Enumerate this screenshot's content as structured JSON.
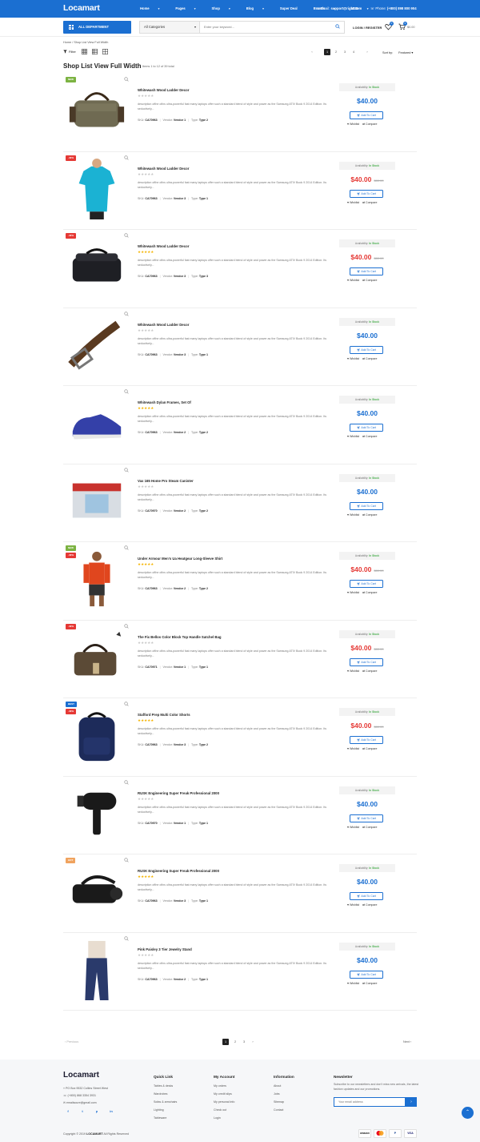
{
  "header": {
    "logo": "Locamart",
    "nav": [
      {
        "label": "Home"
      },
      {
        "label": "Pages"
      },
      {
        "label": "Shop"
      },
      {
        "label": "Blog"
      },
      {
        "label": "Super Deal"
      },
      {
        "label": "Brands"
      },
      {
        "label": "USD"
      }
    ],
    "email_label": "Email:",
    "email": "support@right.com",
    "phone_label": "Phone:",
    "phone": "(+800) 898 800 904",
    "department_label": "ALL DEPARTMENT",
    "category_select": "All Categories",
    "search_placeholder": "Enter your keyword...",
    "login_label": "LOGIN / REGISTER",
    "wishlist_count": "0",
    "cart_count": "0",
    "cart_total": "$0.00"
  },
  "breadcrumb": [
    "Home",
    "Shop List View Full Width"
  ],
  "toolbar": {
    "filter_label": "Filter",
    "pages": [
      "1",
      "2",
      "3",
      "4"
    ],
    "active_page": "1",
    "sort_label": "Sort by:",
    "sort_value": "Featured"
  },
  "page_title": "Shop List View Full Width",
  "results_text": "Items 1 to 12 of 39 total",
  "product_common": {
    "description": "description ofthe ofins ultra-powerful fast many laptops offer such a standard blend of style and power as the Samsung ATIV Book 9 2014 Edition. Its seductively...",
    "availability_label": "Availability:",
    "availability_value": "In Stock",
    "add_to_cart": "Add To Cart",
    "wishlist": "Wishlist",
    "compare": "Compare",
    "sku_label": "SKU:",
    "vendor_label": "Vendor:",
    "type_label": "Type:"
  },
  "products": [
    {
      "title": "Whitewash Wood Ladder Decor",
      "stars": 0,
      "price": "$40.00",
      "old_price": "",
      "sku": "CA70963",
      "vendor": "Vendor 1",
      "type": "Type 2",
      "badges": [
        {
          "text": "NEW",
          "color": "#7cb342"
        }
      ],
      "icon": "duffel-bag-icon"
    },
    {
      "title": "Whitewash Wood Ladder Decor",
      "stars": 0,
      "price": "$40.00",
      "old_price": "$80.00",
      "sku": "CA70963",
      "vendor": "Vendor 3",
      "type": "Type 1",
      "badges": [
        {
          "text": "-40%",
          "color": "#e53935"
        }
      ],
      "icon": "tshirt-icon"
    },
    {
      "title": "Whitewash Wood Ladder Decor",
      "stars": 5,
      "price": "$40.00",
      "old_price": "$80.00",
      "sku": "CA70963",
      "vendor": "Vendor 3",
      "type": "Type 3",
      "badges": [
        {
          "text": "-40%",
          "color": "#e53935"
        }
      ],
      "icon": "bag-icon"
    },
    {
      "title": "Whitewash Wood Ladder Decor",
      "stars": 0,
      "price": "$40.00",
      "old_price": "",
      "sku": "CA70963",
      "vendor": "Vendor 3",
      "type": "Type 1",
      "badges": [],
      "icon": "belt-icon"
    },
    {
      "title": "Whitewash Dylan Frames, Set Of",
      "stars": 5,
      "price": "$40.00",
      "old_price": "",
      "sku": "CA70963",
      "vendor": "Vendor 2",
      "type": "Type 2",
      "badges": [],
      "icon": "shoe-icon"
    },
    {
      "title": "Vax 165 Home Pro Steam Canister",
      "stars": 0,
      "price": "$40.00",
      "old_price": "",
      "sku": "CA70970",
      "vendor": "Vendor 2",
      "type": "Type 2",
      "badges": [],
      "icon": "box-icon"
    },
    {
      "title": "Under Armour Men's Ua Heatgear Long-Sleeve Shirt",
      "stars": 5,
      "price": "$40.00",
      "old_price": "$80.00",
      "sku": "CA70963",
      "vendor": "Vendor 2",
      "type": "Type 2",
      "badges": [
        {
          "text": "NEW",
          "color": "#7cb342"
        },
        {
          "text": "-40%",
          "color": "#e53935"
        }
      ],
      "icon": "man-icon"
    },
    {
      "title": "The Fix Bellos Color Block Top Handle Satchel Bag",
      "stars": 0,
      "price": "$40.00",
      "old_price": "$80.00",
      "sku": "CA70971",
      "vendor": "Vendor 1",
      "type": "Type 1",
      "badges": [
        {
          "text": "-40%",
          "color": "#e53935"
        }
      ],
      "icon": "satchel-icon"
    },
    {
      "title": "Stafford Prep Multi Color Shorts",
      "stars": 5,
      "price": "$40.00",
      "old_price": "$80.00",
      "sku": "CA70963",
      "vendor": "Vendor 3",
      "type": "Type 2",
      "badges": [
        {
          "text": "BEST",
          "color": "#1b6fd1"
        },
        {
          "text": "-40%",
          "color": "#e53935"
        }
      ],
      "icon": "backpack-icon"
    },
    {
      "title": "RUSK Engineering Super Freak Professional 2000",
      "stars": 0,
      "price": "$40.00",
      "old_price": "",
      "sku": "CA70970",
      "vendor": "Vendor 1",
      "type": "Type 1",
      "badges": [],
      "icon": "hair-dryer-icon"
    },
    {
      "title": "RUSK Engineering Super Freak Professional 2000",
      "stars": 5,
      "price": "$40.00",
      "old_price": "",
      "sku": "CA70963",
      "vendor": "Vendor 3",
      "type": "Type 1",
      "badges": [
        {
          "text": "HOT",
          "color": "#f0a35e"
        }
      ],
      "icon": "vr-headset-icon"
    },
    {
      "title": "Pink Paisley 3 Tier Jewelry Stand",
      "stars": 0,
      "price": "$40.00",
      "old_price": "",
      "sku": "CA70963",
      "vendor": "Vendor 2",
      "type": "Type 1",
      "badges": [],
      "icon": "jeans-icon"
    }
  ],
  "bottom_pagination": {
    "prev": "Previous",
    "next": "Next",
    "pages": [
      "1",
      "2",
      "3"
    ]
  },
  "footer": {
    "logo": "Locamart",
    "address": "PO Box 9532 Collins Street West",
    "phone": "(+800) 868 3354 3931",
    "email": "emailsoure@gmail.com",
    "social": [
      "f",
      "t",
      "p",
      "in"
    ],
    "columns": [
      {
        "title": "Quick Link",
        "links": [
          "Tables & desks",
          "Wardrobes",
          "Sofas & armchairs",
          "Lighting",
          "Tableware"
        ]
      },
      {
        "title": "My Account",
        "links": [
          "My orders",
          "My credit slips",
          "My personal info",
          "Check out",
          "Login"
        ]
      },
      {
        "title": "Information",
        "links": [
          "About",
          "Jobs",
          "Sitemap",
          "Contact"
        ]
      }
    ],
    "newsletter_title": "Newsletter",
    "newsletter_text": "Subscribe to our newsletters and don't miss new arrivals, the latest fashion updates and our promotions.",
    "newsletter_placeholder": "Your email address",
    "copyright_prefix": "Copyright © 2019",
    "copyright_brand": "LOCAMART",
    "copyright_suffix": "All Rights Reserved",
    "payments": [
      "amazon",
      "mastercard",
      "paypal",
      "VISA"
    ]
  },
  "colors": {
    "brand": "#1b6fd1",
    "sale": "#e53935",
    "stock": "#4caf50",
    "star": "#f5b400"
  }
}
